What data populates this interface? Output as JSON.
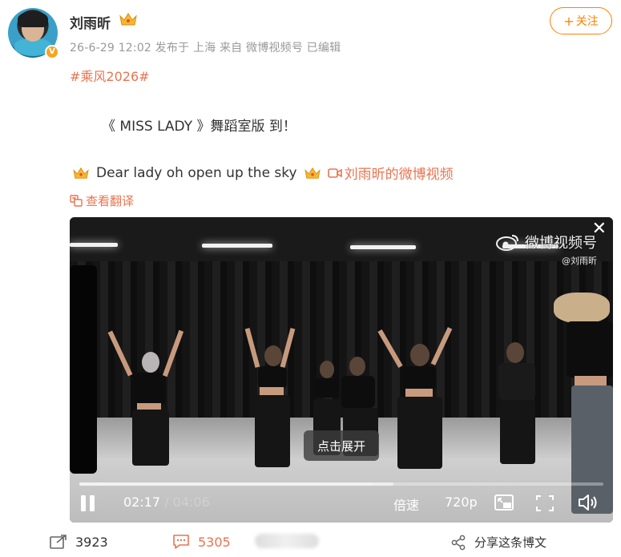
{
  "author": {
    "name": "刘雨昕",
    "meta": "26-6-29 12:02 发布于 上海 来自 微博视频号 已编辑",
    "verified_badge": "V"
  },
  "follow_button": {
    "label": "+关注",
    "plus": "+",
    "text": "关注"
  },
  "post": {
    "topic": "#乘风2026#",
    "line1": "《 MISS LADY 》舞蹈室版 到！",
    "line2_text": "Dear lady oh open up the sky",
    "video_link": "刘雨昕的微博视频",
    "translate": "查看翻译"
  },
  "video": {
    "watermark": "微博视频号",
    "watermark_sub": "@刘雨昕",
    "expand_label": "点击展开",
    "current_time": "02:17",
    "separator": " / ",
    "total_time": "04:06",
    "progress": 0.56,
    "buffered": 0.6,
    "speed_label": "倍速",
    "quality_label": "720p"
  },
  "actions": {
    "repost_count": "3923",
    "comment_count": "5305",
    "share_label": "分享这条博文"
  },
  "colors": {
    "accent": "#ff8200",
    "link": "#eb7350",
    "meta": "#999999"
  }
}
